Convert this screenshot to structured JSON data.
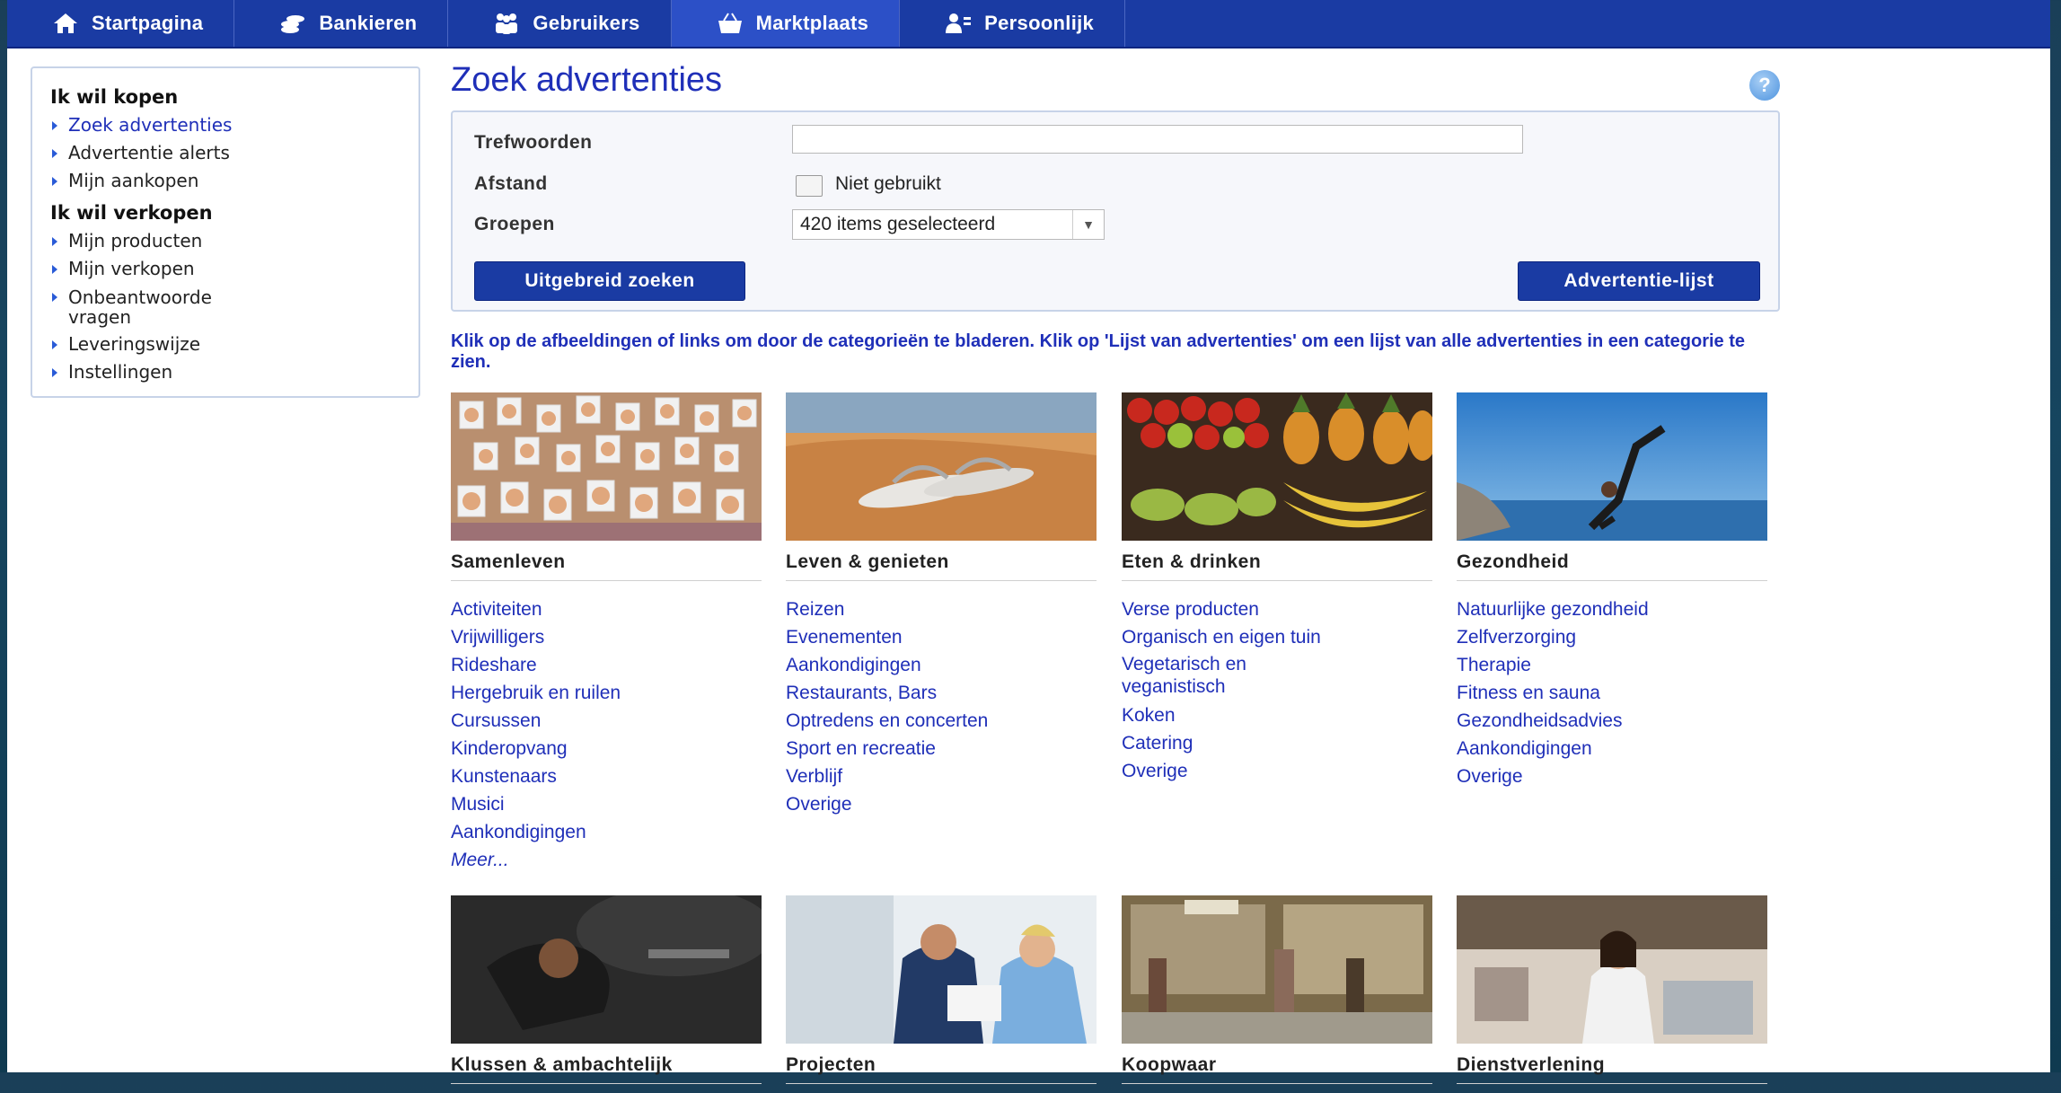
{
  "nav": {
    "items": [
      {
        "label": "Startpagina",
        "icon": "home-icon"
      },
      {
        "label": "Bankieren",
        "icon": "coins-icon"
      },
      {
        "label": "Gebruikers",
        "icon": "users-icon"
      },
      {
        "label": "Marktplaats",
        "icon": "basket-icon"
      },
      {
        "label": "Persoonlijk",
        "icon": "person-icon"
      }
    ],
    "active": "Marktplaats"
  },
  "sidebar": {
    "buy_heading": "Ik wil kopen",
    "buy_items": [
      "Zoek advertenties",
      "Advertentie alerts",
      "Mijn aankopen"
    ],
    "sell_heading": "Ik wil verkopen",
    "sell_items": [
      "Mijn producten",
      "Mijn verkopen",
      "Onbeantwoorde vragen",
      "Leveringswijze",
      "Instellingen"
    ]
  },
  "main": {
    "title": "Zoek advertenties",
    "help": "?",
    "search": {
      "keywords_label": "Trefwoorden",
      "keywords_value": "",
      "distance_label": "Afstand",
      "distance_checkbox_label": "Niet gebruikt",
      "groups_label": "Groepen",
      "groups_value": "420 items geselecteerd",
      "advanced_button": "Uitgebreid zoeken",
      "list_button": "Advertentie-lijst"
    },
    "intro": "Klik op de afbeeldingen of links om door de categorieën te bladeren. Klik op 'Lijst van advertenties' om een lijst van alle advertenties in een categorie te zien."
  },
  "categories": [
    {
      "title": "Samenleven",
      "links": [
        "Activiteiten",
        "Vrijwilligers",
        "Rideshare",
        "Hergebruik en ruilen",
        "Cursussen",
        "Kinderopvang",
        "Kunstenaars",
        "Musici",
        "Aankondigingen"
      ],
      "more": "Meer..."
    },
    {
      "title": "Leven & genieten",
      "links": [
        "Reizen",
        "Evenementen",
        "Aankondigingen",
        "Restaurants, Bars",
        "Optredens en concerten",
        "Sport en recreatie",
        "Verblijf",
        "Overige"
      ]
    },
    {
      "title": "Eten & drinken",
      "links": [
        "Verse producten",
        "Organisch en eigen tuin",
        "Vegetarisch en veganistisch",
        "Koken",
        "Catering",
        "Overige"
      ]
    },
    {
      "title": "Gezondheid",
      "links": [
        "Natuurlijke gezondheid",
        "Zelfverzorging",
        "Therapie",
        "Fitness en sauna",
        "Gezondheidsadvies",
        "Aankondigingen",
        "Overige"
      ]
    },
    {
      "title": "Klussen & ambachtelijk",
      "links": []
    },
    {
      "title": "Projecten",
      "links": []
    },
    {
      "title": "Koopwaar",
      "links": []
    },
    {
      "title": "Dienstverlening",
      "links": []
    }
  ]
}
